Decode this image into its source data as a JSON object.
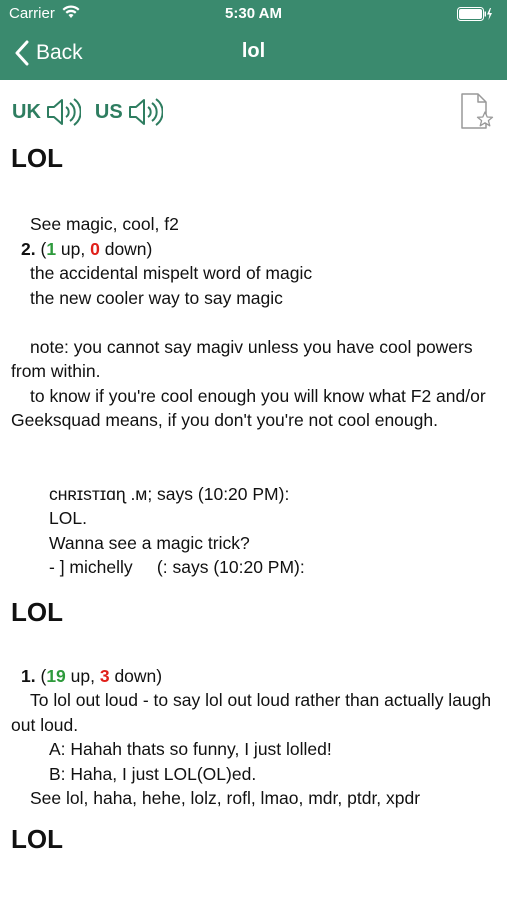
{
  "status": {
    "carrier": "Carrier",
    "time": "5:30 AM"
  },
  "nav": {
    "back_label": "Back",
    "title": "lol"
  },
  "pronunciation": {
    "uk_label": "UK",
    "us_label": "US"
  },
  "entries": {
    "e1_title": "LOL",
    "e1_see": "See magic, cool, f2",
    "e1_num": "2.",
    "e1_up": "1",
    "e1_up_word": " up, ",
    "e1_down": "0",
    "e1_down_word": " down)",
    "e1_open": " (",
    "e1_l1": "the accidental mispelt word of magic",
    "e1_l2": "the new cooler way to say magic",
    "e1_note": "note: you cannot say magiv unless you have cool powers from within.",
    "e1_know": "to know if you're cool enough you will know what F2 and/or Geeksquad means, if you don't you're not cool enough.",
    "e1_c1": "ᴄʜʀɪsᴛɪɑɳ .ᴍ; says (10:20 PM):",
    "e1_c2": "LOL.",
    "e1_c3": "Wanna see a magic trick?",
    "e1_c4": "- ] michelly     (: says (10:20 PM):",
    "e2_title": "LOL",
    "e2_num": "1.",
    "e2_open": " (",
    "e2_up": "19",
    "e2_up_word": " up, ",
    "e2_down": "3",
    "e2_down_word": " down)",
    "e2_def": "To lol out loud - to say lol out loud rather than actually laugh out loud.",
    "e2_a": "A: Hahah thats so funny, I just lolled!",
    "e2_b": "B: Haha, I just LOL(OL)ed.",
    "e2_see": "See lol, haha, hehe, lolz, rofl, lmao, mdr, ptdr, xpdr",
    "e3_title": "LOL"
  },
  "colors": {
    "header": "#3a8a6e",
    "accent": "#2e7d60",
    "up": "#2e9a3c",
    "down": "#e0201a"
  },
  "icons": [
    "wifi-icon",
    "battery-icon",
    "chevron-left-icon",
    "speaker-icon",
    "favorite-document-icon"
  ]
}
